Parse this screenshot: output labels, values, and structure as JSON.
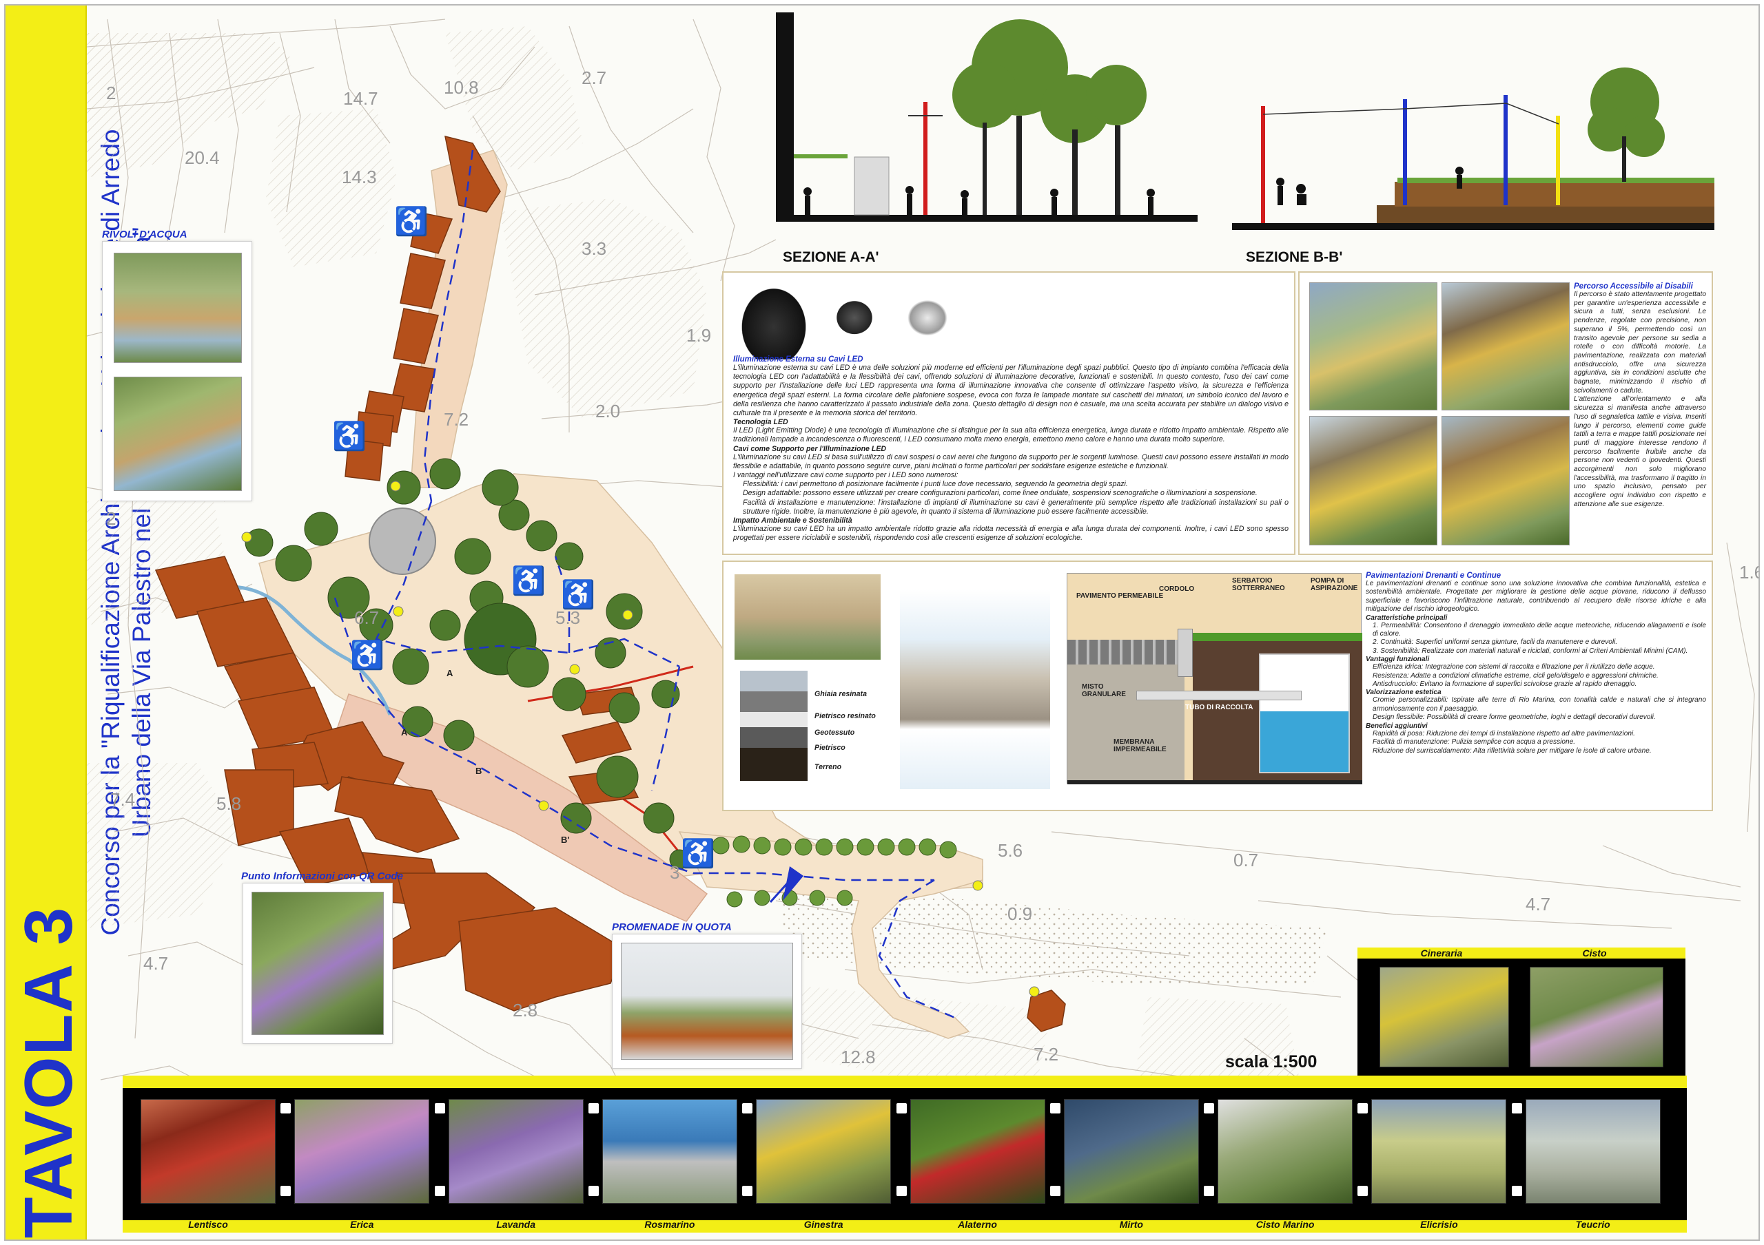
{
  "title": {
    "tavola": "TAVOLA 3",
    "lines": [
      "Concorso per la \"Riqualificazione Architettonica, Urbanistica e di Arredo",
      "Urbano della Via Palestro nel Municipio di Rio Marina\""
    ]
  },
  "elevations": [
    "2",
    "14.7",
    "10.8",
    "2.7",
    "20.4",
    "14.3",
    "3.3",
    "1.9",
    "2.0",
    "7.2",
    "2",
    "6.7",
    "5.3",
    "7.4",
    "5.8",
    "4.7",
    "2.8",
    "3",
    "5.6",
    "0.9",
    "0.7",
    "4.7",
    "12.8",
    "7.2",
    "1.6"
  ],
  "map_letters": [
    "A",
    "A",
    "B",
    "B'"
  ],
  "insets": {
    "rivoli": "RIVOLI D'ACQUA",
    "qr": "Punto Informazioni con QR Code",
    "promenade": "PROMENADE IN QUOTA"
  },
  "sections": {
    "aa": "SEZIONE A-A'",
    "bb": "SEZIONE B-B'"
  },
  "led_panel": {
    "title": "Illuminazione Esterna su Cavi LED",
    "intro": "L'illuminazione esterna su cavi LED è una delle soluzioni più moderne ed efficienti per l'illuminazione degli spazi pubblici. Questo tipo di impianto combina l'efficacia della tecnologia LED con l'adattabilità e la flessibilità dei cavi, offrendo soluzioni di illuminazione decorative, funzionali e sostenibili. In questo contesto, l'uso dei cavi come supporto per l'installazione delle luci LED rappresenta una forma di illuminazione innovativa che consente di ottimizzare l'aspetto visivo, la sicurezza e l'efficienza energetica degli spazi esterni. La forma circolare delle plafoniere sospese, evoca con forza le lampade montate sui caschetti dei minatori, un simbolo iconico del lavoro e della resilienza che hanno caratterizzato il passato industriale della zona. Questo dettaglio di design non è casuale, ma una scelta accurata per stabilire un dialogo visivo e culturale tra il presente e la memoria storica del territorio.",
    "h1": "Tecnologia LED",
    "p1": "Il LED (Light Emitting Diode) è una tecnologia di illuminazione che si distingue per la sua alta efficienza energetica, lunga durata e ridotto impatto ambientale. Rispetto alle tradizionali lampade a incandescenza o fluorescenti, i LED consumano molta meno energia, emettono meno calore e hanno una durata molto superiore.",
    "h2": "Cavi come Supporto per l'Illuminazione LED",
    "p2": "L'illuminazione su cavi LED si basa sull'utilizzo di cavi sospesi o cavi aerei che fungono da supporto per le sorgenti luminose. Questi cavi possono essere installati in modo flessibile e adattabile, in quanto possono seguire curve, piani inclinati o forme particolari per soddisfare esigenze estetiche e funzionali.",
    "p3": "I vantaggi nell'utilizzare cavi come supporto per i LED sono numerosi:",
    "b1": "Flessibilità: i cavi permettono di posizionare facilmente i punti luce dove necessario, seguendo la geometria degli spazi.",
    "b2": "Design adattabile: possono essere utilizzati per creare configurazioni particolari, come linee ondulate, sospensioni scenografiche o illuminazioni a sospensione.",
    "b3": "Facilità di installazione e manutenzione: l'installazione di impianti di illuminazione su cavi è generalmente più semplice rispetto alle tradizionali installazioni su pali o strutture rigide. Inoltre, la manutenzione è più agevole, in quanto il sistema di illuminazione può essere facilmente accessibile.",
    "h3": "Impatto Ambientale e Sostenibilità",
    "p4": "L'illuminazione su cavi LED ha un impatto ambientale ridotto grazie alla ridotta necessità di energia e alla lunga durata dei componenti. Inoltre, i cavi LED sono spesso progettati per essere riciclabili e sostenibili, rispondendo così alle crescenti esigenze di soluzioni ecologiche."
  },
  "access_panel": {
    "title": "Percorso Accessibile ai Disabili",
    "p1": "Il percorso è stato attentamente progettato per garantire un'esperienza accessibile e sicura a tutti, senza esclusioni. Le pendenze, regolate con precisione, non superano il 5%, permettendo così un transito agevole per persone su sedia a rotelle o con difficoltà motorie. La pavimentazione, realizzata con materiali antisdrucciolo, offre una sicurezza aggiuntiva, sia in condizioni asciutte che bagnate, minimizzando il rischio di scivolamenti o cadute.",
    "p2": "L'attenzione all'orientamento e alla sicurezza si manifesta anche attraverso l'uso di segnaletica tattile e visiva. Inseriti lungo il percorso, elementi come guide tattili a terra e mappe tattili posizionate nei punti di maggiore interesse rendono il percorso facilmente fruibile anche da persone non vedenti o ipovedenti. Questi accorgimenti non solo migliorano l'accessibilità, ma trasformano il tragitto in uno spazio inclusivo, pensato per accogliere ogni individuo con rispetto e attenzione alle sue esigenze."
  },
  "paving_panel": {
    "labels": [
      "Ghiaia resinata",
      "Pietrisco resinato",
      "Geotessuto",
      "Pietrisco",
      "Terreno"
    ],
    "diagram_labels": [
      "PAVIMENTO PERMEABILE",
      "CORDOLO",
      "SERBATOIO SOTTERRANEO",
      "POMPA DI ASPIRAZIONE",
      "MISTO GRANULARE",
      "TUBO DI RACCOLTA",
      "MEMBRANA IMPERMEABILE"
    ],
    "title": "Pavimentazioni Drenanti e Continue",
    "intro": "Le pavimentazioni drenanti e continue sono una soluzione innovativa che combina funzionalità, estetica e sostenibilità ambientale. Progettate per migliorare la gestione delle acque piovane, riducono il deflusso superficiale e favoriscono l'infiltrazione naturale, contribuendo al recupero delle risorse idriche e alla mitigazione del rischio idrogeologico.",
    "h1": "Caratteristiche principali",
    "c1": "1.  Permeabilità: Consentono il drenaggio immediato delle acque meteoriche, riducendo allagamenti e isole di calore.",
    "c2": "2.  Continuità: Superfici uniformi senza giunture, facili da manutenere e durevoli.",
    "c3": "3.  Sostenibilità: Realizzate con materiali naturali e riciclati, conformi ai Criteri Ambientali Minimi (CAM).",
    "h2": "Vantaggi funzionali",
    "v1": "Efficienza idrica: Integrazione con sistemi di raccolta e filtrazione per il riutilizzo delle acque.",
    "v2": "Resistenza: Adatte a condizioni climatiche estreme, cicli gelo/disgelo e aggressioni chimiche.",
    "v3": "Antisdrucciolo: Evitano la formazione di superfici scivolose grazie al rapido drenaggio.",
    "h3": "Valorizzazione estetica",
    "e1": "Cromie personalizzabili: Ispirate alle terre di Rio Marina, con tonalità calde e naturali che si integrano armoniosamente con il paesaggio.",
    "e2": "Design flessibile: Possibilità di creare forme geometriche, loghi e dettagli decorativi durevoli.",
    "h4": "Benefici aggiuntivi",
    "a1": "Rapidità di posa: Riduzione dei tempi di installazione rispetto ad altre pavimentazioni.",
    "a2": "Facilità di manutenzione: Pulizia semplice con acqua a pressione.",
    "a3": "Riduzione del surriscaldamento: Alta riflettività solare per mitigare le isole di calore urbane."
  },
  "plants_top": [
    "Cineraria",
    "Cisto"
  ],
  "plants_bottom": [
    "Lentisco",
    "Erica",
    "Lavanda",
    "Rosmarino",
    "Ginestra",
    "Alaterno",
    "Mirto",
    "Cisto Marino",
    "Elicrisio",
    "Teucrio"
  ],
  "scale": "scala 1:500",
  "colors": {
    "title_blue": "#1f33c9",
    "band_yellow": "#f3ee16",
    "building": "#b5501b",
    "path": "#f1dcc4"
  }
}
